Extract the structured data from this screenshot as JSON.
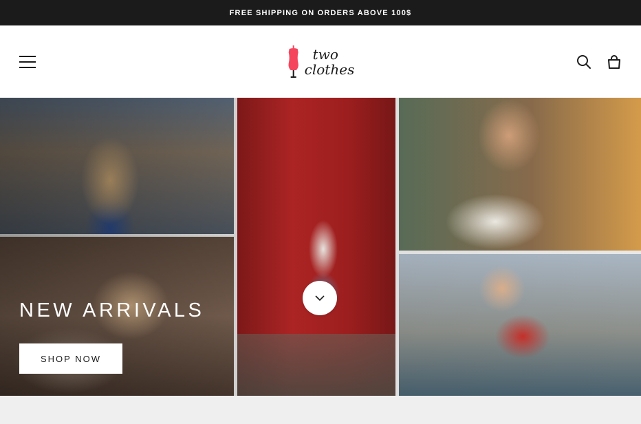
{
  "announcement": {
    "text": "FREE SHIPPING ON ORDERS ABOVE 100$"
  },
  "header": {
    "logo_line1": "two",
    "logo_line2": "clothes",
    "menu_icon": "hamburger-icon",
    "search_icon": "search-icon",
    "cart_icon": "shopping-bag-icon",
    "logo_icon": "dress-form-icon",
    "logo_color": "#f5455c"
  },
  "hero": {
    "title": "NEW ARRIVALS",
    "button_label": "SHOP NOW",
    "scroll_icon": "chevron-down-icon"
  }
}
